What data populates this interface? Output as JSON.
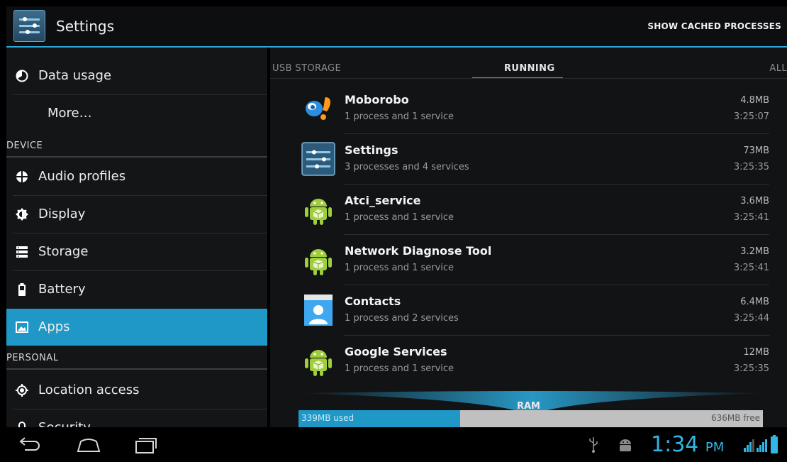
{
  "header": {
    "title": "Settings",
    "show_cached": "SHOW CACHED PROCESSES",
    "icon": "settings-sliders-icon"
  },
  "sidebar": {
    "items": [
      {
        "label": "Data usage",
        "icon": "data-usage-icon"
      },
      {
        "label": "More…",
        "icon": ""
      },
      {
        "section": "DEVICE"
      },
      {
        "label": "Audio profiles",
        "icon": "audio-profiles-icon"
      },
      {
        "label": "Display",
        "icon": "display-icon"
      },
      {
        "label": "Storage",
        "icon": "storage-icon"
      },
      {
        "label": "Battery",
        "icon": "battery-icon"
      },
      {
        "label": "Apps",
        "icon": "apps-icon",
        "selected": true
      },
      {
        "section": "PERSONAL"
      },
      {
        "label": "Location access",
        "icon": "location-icon"
      },
      {
        "label": "Security",
        "icon": "lock-icon"
      }
    ]
  },
  "tabs": [
    {
      "label": "USB STORAGE"
    },
    {
      "label": "RUNNING",
      "active": true
    },
    {
      "label": "ALL"
    }
  ],
  "running": [
    {
      "name": "Moborobo",
      "sub": "1 process and 1 service",
      "mem": "4.8MB",
      "time": "3:25:07",
      "icon": "moborobo-icon"
    },
    {
      "name": "Settings",
      "sub": "3 processes and 4 services",
      "mem": "73MB",
      "time": "3:25:35",
      "icon": "settings-app-icon"
    },
    {
      "name": "Atci_service",
      "sub": "1 process and 1 service",
      "mem": "3.6MB",
      "time": "3:25:41",
      "icon": "android-icon"
    },
    {
      "name": "Network Diagnose Tool",
      "sub": "1 process and 1 service",
      "mem": "3.2MB",
      "time": "3:25:41",
      "icon": "android-icon"
    },
    {
      "name": "Contacts",
      "sub": "1 process and 2 services",
      "mem": "6.4MB",
      "time": "3:25:44",
      "icon": "contacts-icon"
    },
    {
      "name": "Google Services",
      "sub": "1 process and 1 service",
      "mem": "12MB",
      "time": "3:25:35",
      "icon": "android-icon"
    }
  ],
  "ram": {
    "label": "RAM",
    "used": "339MB used",
    "free": "636MB free",
    "used_fraction": 0.348
  },
  "statusbar": {
    "time": "1:34",
    "ampm": "PM"
  },
  "colors": {
    "accent": "#33b5e5",
    "selected": "#1f98c7",
    "background": "#121315"
  }
}
